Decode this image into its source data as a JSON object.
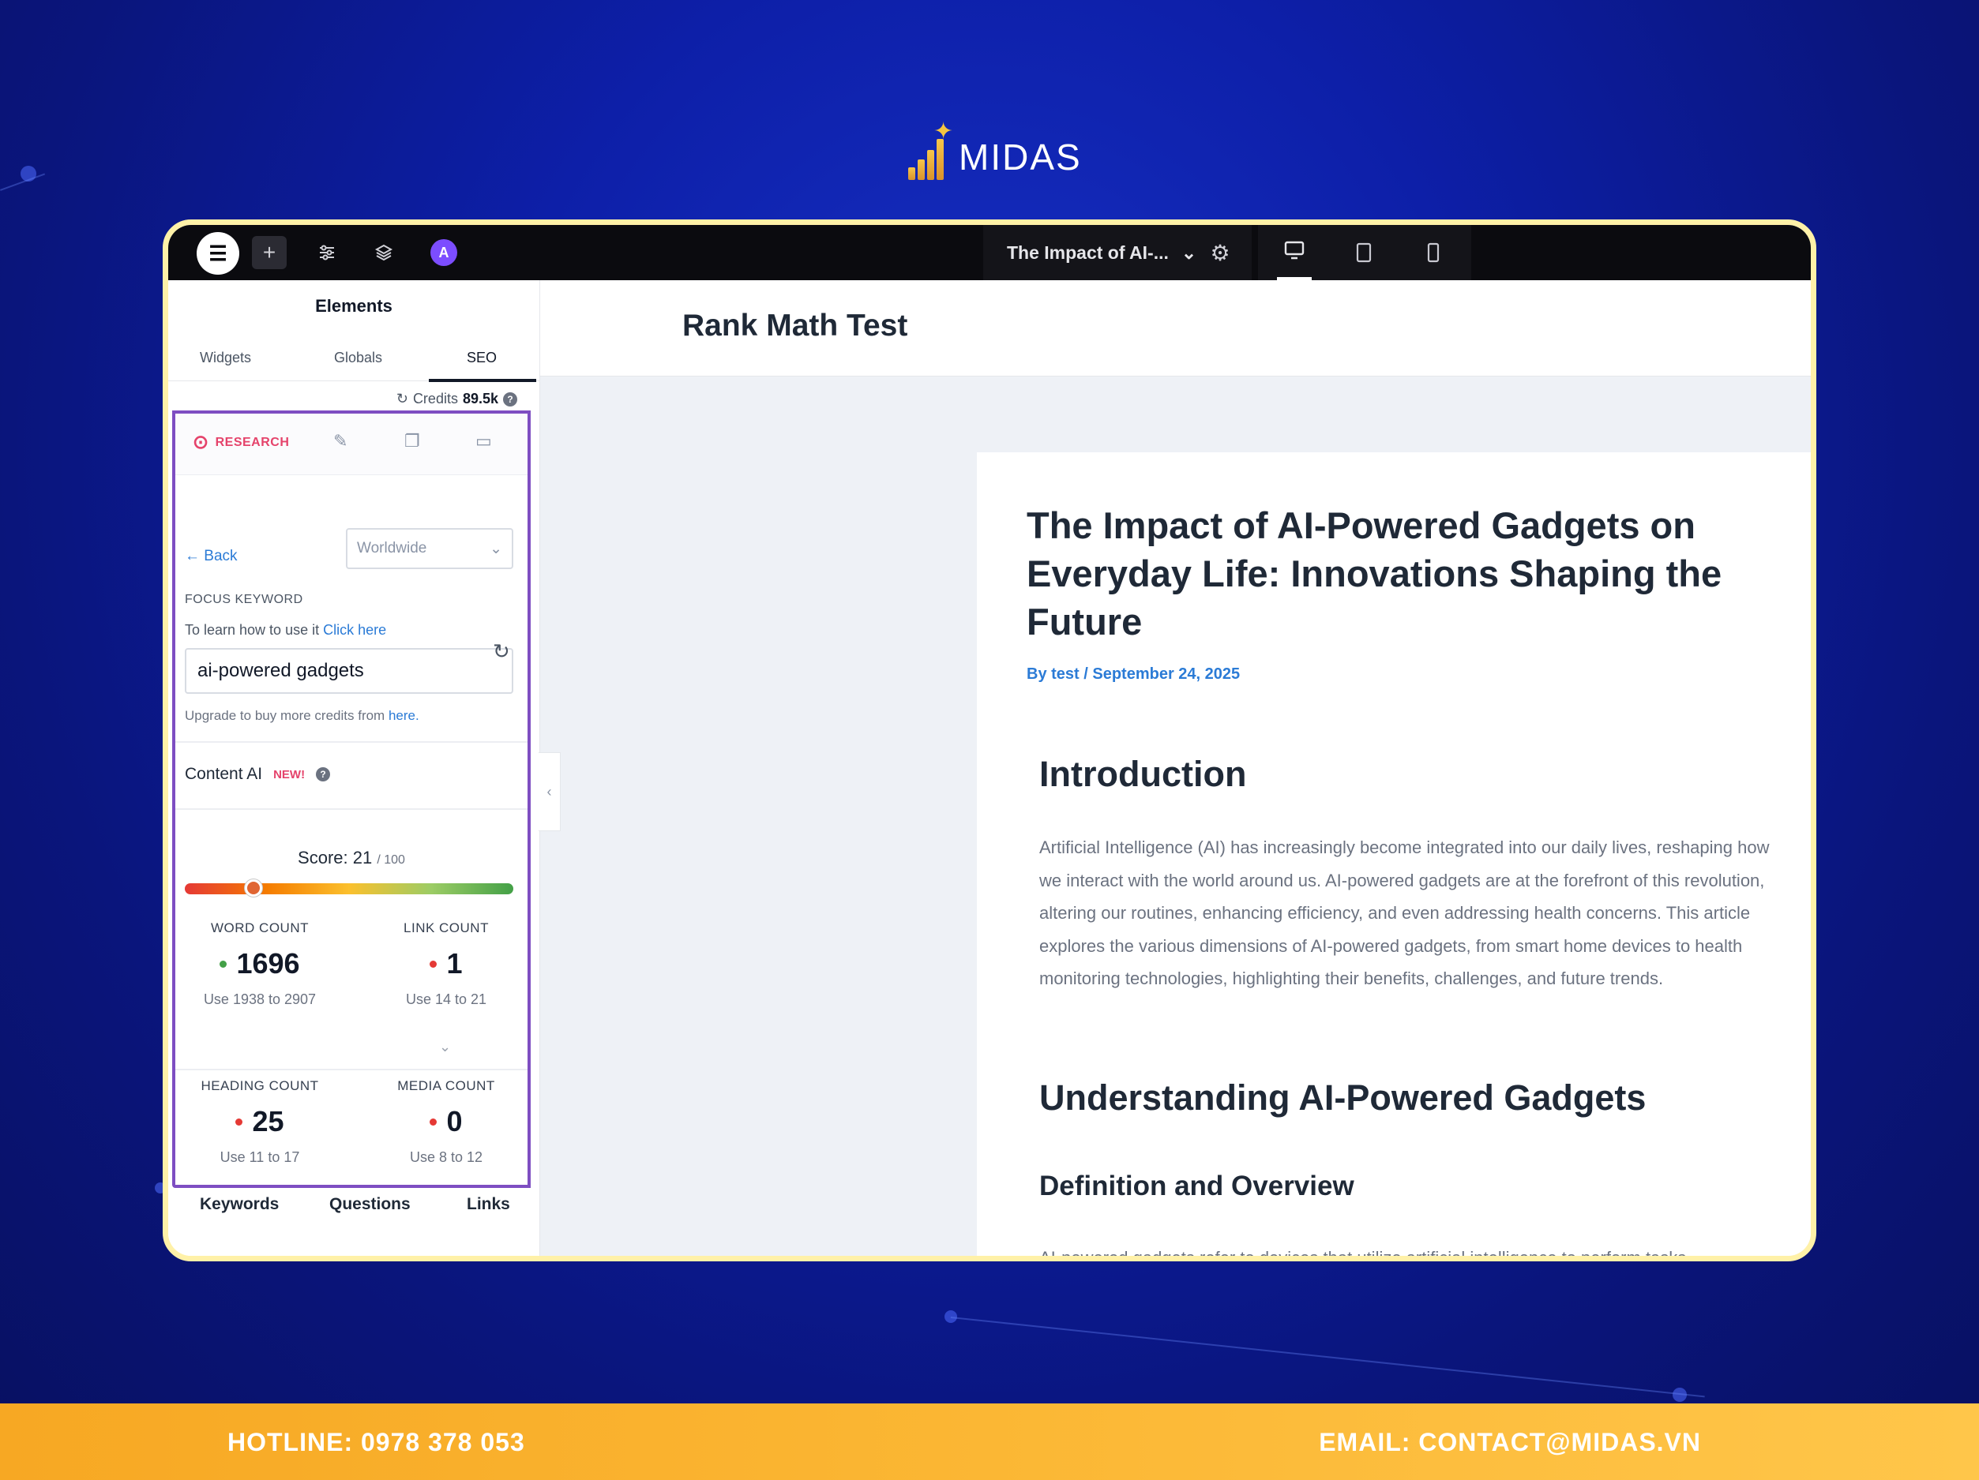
{
  "brand": {
    "name": "MIDAS"
  },
  "toolbar": {
    "elementor_icon": "elementor-icon",
    "add_icon": "plus-icon",
    "settings_icon": "sliders-icon",
    "layers_icon": "layers-icon",
    "ai_icon_letter": "A",
    "page_title": "The Impact of AI-...",
    "devices": [
      "desktop",
      "tablet",
      "mobile"
    ],
    "active_device": "desktop"
  },
  "sidebar": {
    "title": "Elements",
    "tabs": [
      "Widgets",
      "Globals",
      "SEO"
    ],
    "active_tab": "SEO",
    "credits_label": "Credits",
    "credits_value": "89.5k"
  },
  "seo": {
    "research_tab": "RESEARCH",
    "back_label": "← Back",
    "region": "Worldwide",
    "focus_keyword_label": "FOCUS KEYWORD",
    "focus_help_text": "To learn how to use it",
    "focus_help_link": "Click here",
    "keyword_value": "ai-powered gadgets",
    "upgrade_text": "Upgrade to buy more credits from",
    "upgrade_link": "here.",
    "content_ai_label": "Content AI",
    "content_ai_badge": "NEW!",
    "score_label": "Score: 21",
    "score_max": "/ 100",
    "score_value": 21,
    "stats": [
      {
        "label": "WORD COUNT",
        "value": "1696",
        "hint": "Use 1938 to 2907",
        "status": "green"
      },
      {
        "label": "LINK COUNT",
        "value": "1",
        "hint": "Use 14 to 21",
        "status": "red"
      },
      {
        "label": "HEADING COUNT",
        "value": "25",
        "hint": "Use 11 to 17",
        "status": "red"
      },
      {
        "label": "MEDIA COUNT",
        "value": "0",
        "hint": "Use 8 to 12",
        "status": "red"
      }
    ],
    "bottom_tabs": [
      "Keywords",
      "Questions",
      "Links"
    ]
  },
  "preview": {
    "site_title": "Rank Math Test",
    "article_title": "The Impact of AI-Powered Gadgets on Everyday Life: Innovations Shaping the Future",
    "byline": "By test / September 24, 2025",
    "intro_heading": "Introduction",
    "intro_text": "Artificial Intelligence (AI) has increasingly become integrated into our daily lives, reshaping how we interact with the world around us. AI-powered gadgets are at the forefront of this revolution, altering our routines, enhancing efficiency, and even addressing health concerns. This article explores the various dimensions of AI-powered gadgets, from smart home devices to health monitoring technologies, highlighting their benefits, challenges, and future trends.",
    "section_heading": "Understanding AI-Powered Gadgets",
    "sub_heading": "Definition and Overview",
    "sub_text": "AI-powered gadgets refer to devices that utilize artificial intelligence to perform tasks"
  },
  "footer": {
    "hotline": "HOTLINE: 0978 378 053",
    "email": "EMAIL: CONTACT@MIDAS.VN"
  },
  "colors": {
    "background": "#0d1fa8",
    "frame_border": "#fff1a8",
    "seo_panel_border": "#7e4ec2",
    "accent_pink": "#e5436b",
    "link_blue": "#2b7bd6",
    "footer": "#fbb734"
  }
}
